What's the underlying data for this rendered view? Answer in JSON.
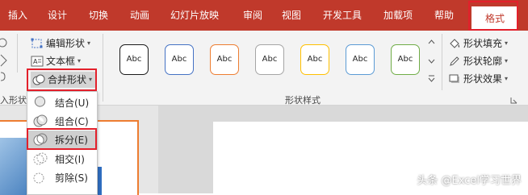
{
  "tabs": [
    {
      "label": "插入"
    },
    {
      "label": "设计"
    },
    {
      "label": "切换"
    },
    {
      "label": "动画"
    },
    {
      "label": "幻灯片放映"
    },
    {
      "label": "审阅"
    },
    {
      "label": "视图"
    },
    {
      "label": "开发工具"
    },
    {
      "label": "加载项"
    },
    {
      "label": "帮助"
    },
    {
      "label": "格式"
    }
  ],
  "insert_shapes": {
    "edit_shape": "编辑形状",
    "text_box": "文本框",
    "merge_shapes": "合并形状",
    "group_label": "入形状"
  },
  "shape_styles": {
    "sample_text": "Abc",
    "group_label": "形状样式",
    "fill": "形状填充",
    "outline": "形状轮廓",
    "effects": "形状效果"
  },
  "merge_menu": {
    "items": [
      {
        "label": "结合(U)"
      },
      {
        "label": "组合(C)"
      },
      {
        "label": "拆分(E)"
      },
      {
        "label": "相交(I)"
      },
      {
        "label": "剪除(S)"
      }
    ]
  },
  "watermark": "头条 @Excel学习世界",
  "colors": {
    "ribbon_tab_bar": "#c0392b",
    "highlight_box": "#e3202b",
    "slide_border": "#ed7d31",
    "style_borders": [
      "#1a1a1a",
      "#4472c4",
      "#ed7d31",
      "#a5a5a5",
      "#ffc000",
      "#5b9bd5",
      "#70ad47"
    ]
  }
}
